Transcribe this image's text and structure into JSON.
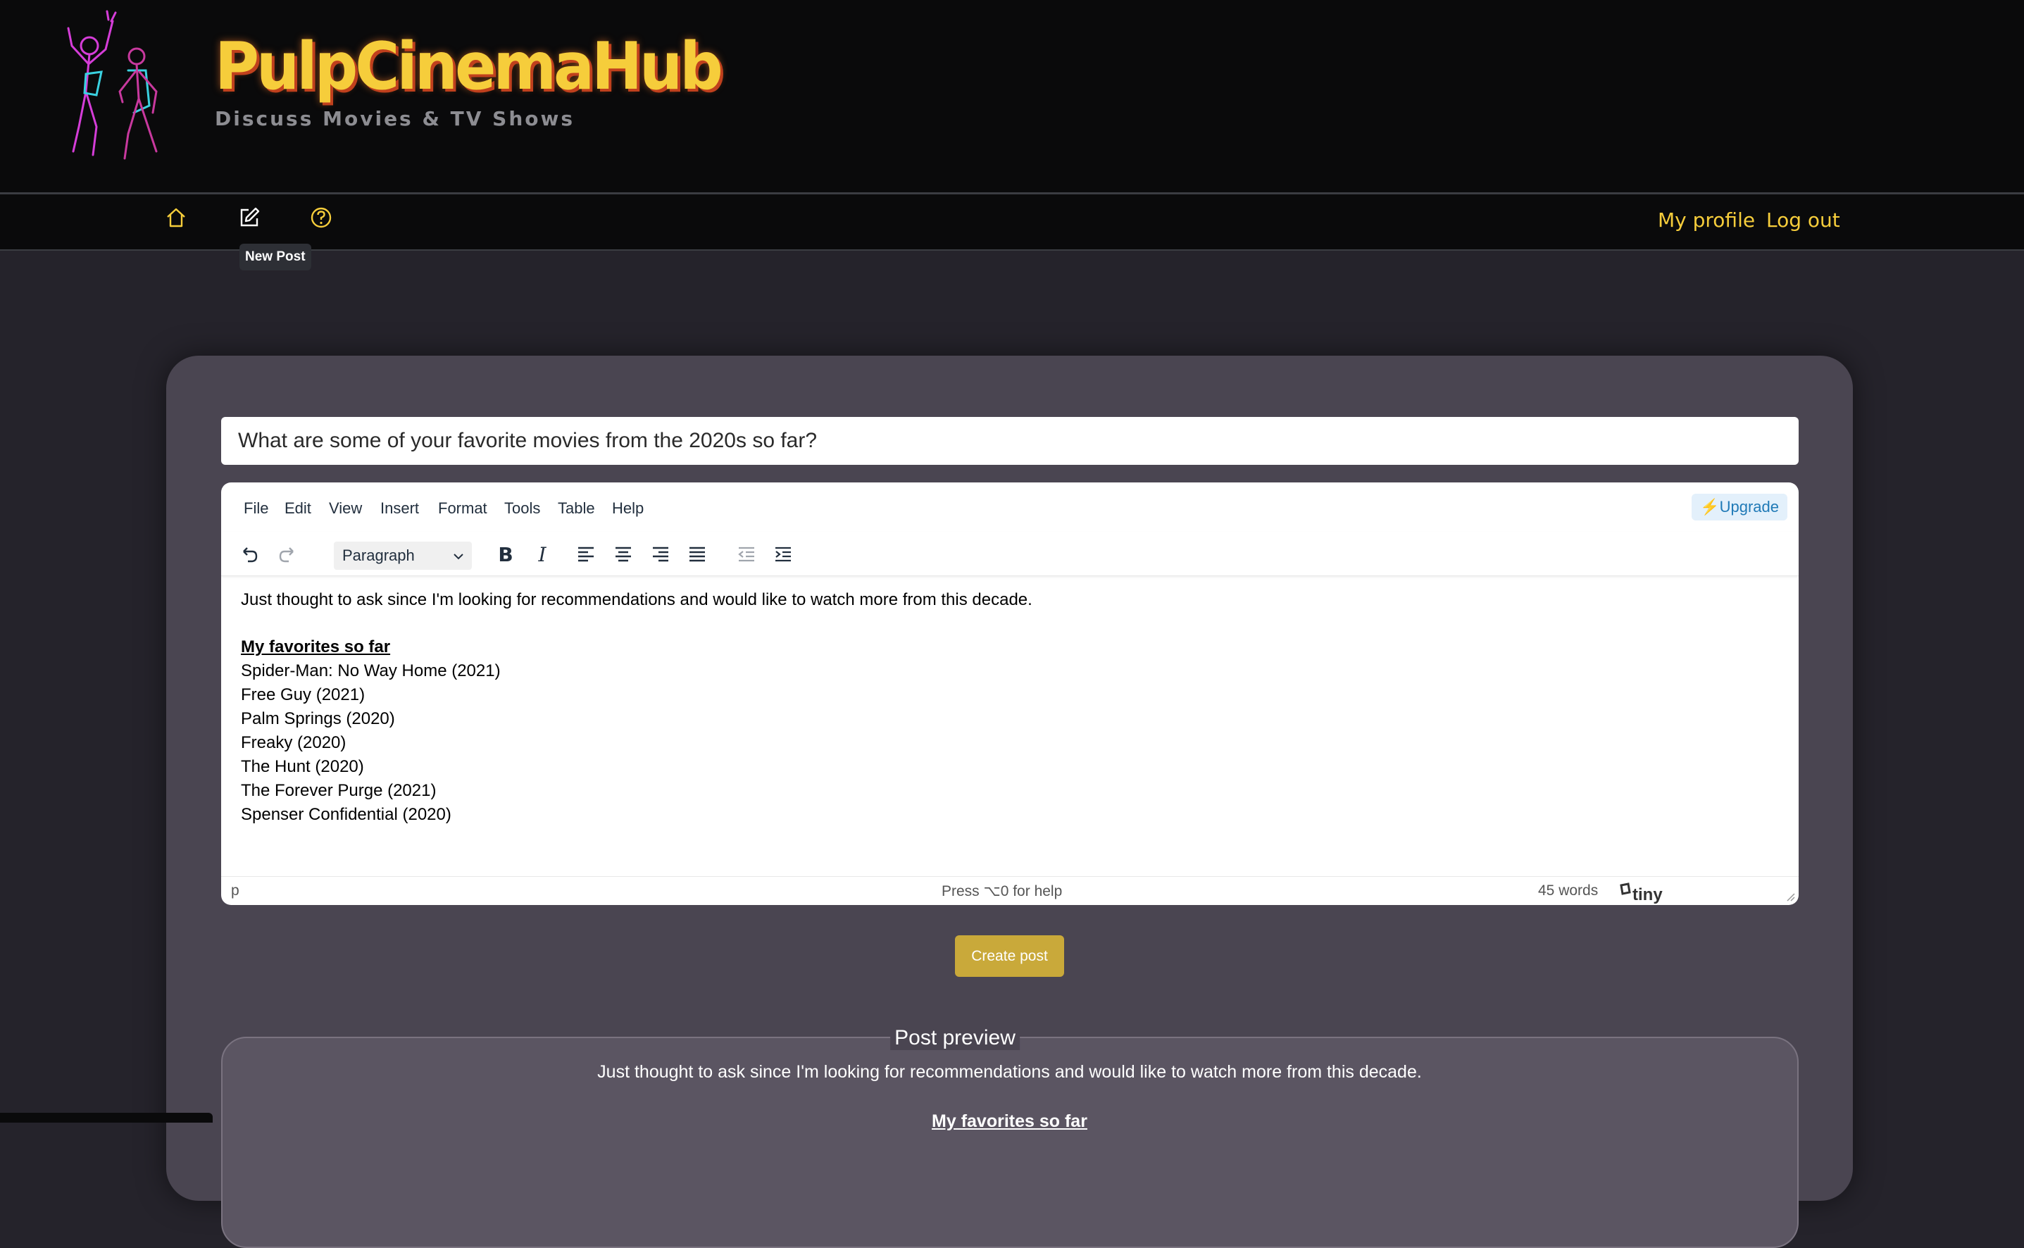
{
  "brand": {
    "title": "PulpCinemaHub",
    "subtitle": "Discuss Movies & TV Shows"
  },
  "nav": {
    "icons": [
      "home-icon",
      "edit-icon",
      "help-icon"
    ],
    "tooltip": "New Post",
    "profile": "My profile",
    "logout": "Log out",
    "accent": "#f6cd3b"
  },
  "post": {
    "title_value": "What are some of your favorite movies from the 2020s so far?"
  },
  "editor": {
    "menu": [
      "File",
      "Edit",
      "View",
      "Insert",
      "Format",
      "Tools",
      "Table",
      "Help"
    ],
    "upgrade": "⚡Upgrade",
    "block_format": "Paragraph",
    "content": {
      "intro": "Just thought to ask since I'm looking for recommendations and would like to watch more from this decade.",
      "heading": "My favorites so far",
      "items": [
        "Spider-Man: No Way Home (2021)",
        "Free Guy (2021)",
        "Palm Springs (2020)",
        "Freaky (2020)",
        "The Hunt (2020)",
        "The Forever Purge (2021)",
        "Spenser Confidential (2020)"
      ]
    },
    "status": {
      "path": "p",
      "help": "Press ⌥0 for help",
      "words": "45 words",
      "brand": "tiny"
    }
  },
  "actions": {
    "create": "Create post",
    "button_color": "#c9a93a"
  },
  "preview": {
    "legend": "Post preview",
    "intro": "Just thought to ask since I'm looking for recommendations and would like to watch more from this decade.",
    "heading": "My favorites so far"
  }
}
